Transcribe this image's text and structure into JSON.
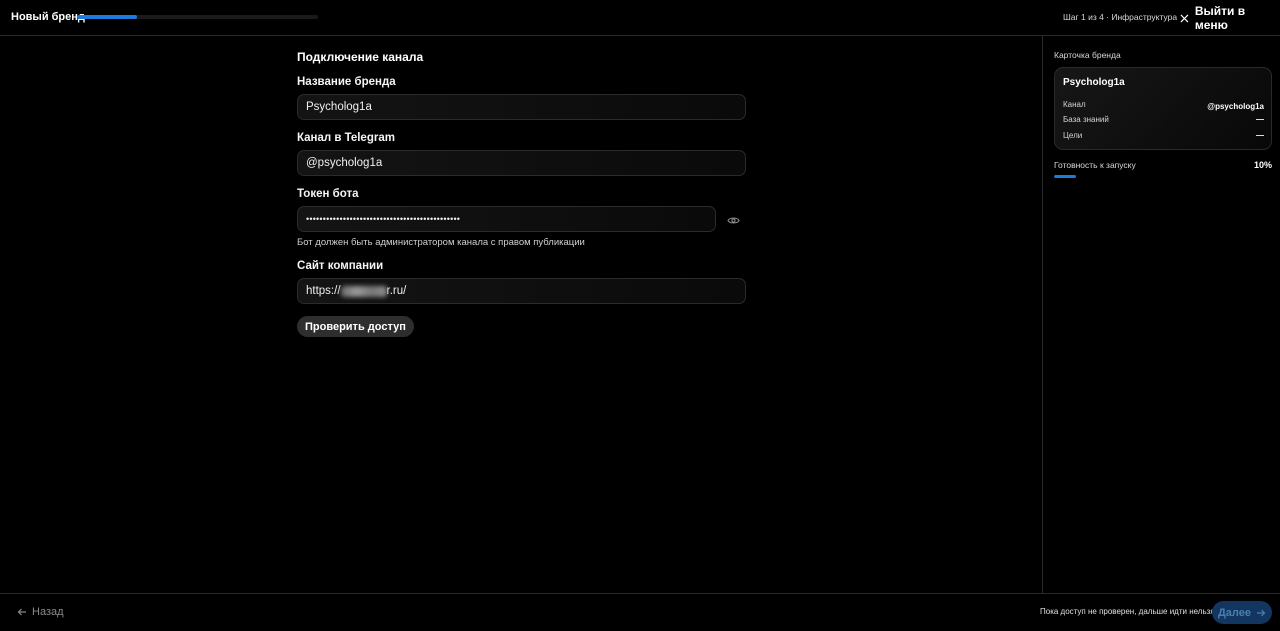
{
  "header": {
    "title": "Новый бренд",
    "progress": 0.25,
    "step_label": "Шаг 1 из 4 · Инфраструктура",
    "exit_label": "Выйти в меню"
  },
  "form": {
    "section_title": "Подключение канала",
    "brand_name": {
      "label": "Название бренда",
      "value": "Psycholog1a"
    },
    "channel": {
      "label": "Канал в Telegram",
      "value": "@psycholog1a"
    },
    "token": {
      "label": "Токен бота",
      "value": "••••••••••••••••••••••••••••••••••••••••••••••",
      "hint": "Бот должен быть администратором канала с правом публикации"
    },
    "site": {
      "label": "Сайт компании",
      "value_prefix": "https://",
      "value_suffix": "r.ru/"
    },
    "check_button": "Проверить доступ"
  },
  "sidebar": {
    "title": "Карточка бренда",
    "card": {
      "name": "Psycholog1a",
      "rows": [
        {
          "label": "Канал",
          "value": "@psycholog1a"
        },
        {
          "label": "База знаний",
          "value": "—"
        },
        {
          "label": "Цели",
          "value": "—"
        }
      ]
    },
    "readiness": {
      "label": "Готовность к запуску",
      "value": "10%",
      "fraction": 0.1
    }
  },
  "footer": {
    "back_label": "Назад",
    "note": "Пока доступ не проверен, дальше идти нельзя",
    "next_label": "Далее"
  },
  "colors": {
    "accent": "#1d7be0",
    "next_button_bg": "#12365f",
    "background": "#000000"
  },
  "icons": {
    "exit": "close-icon",
    "eye": "eye-icon",
    "back": "arrow-left-icon",
    "next": "arrow-right-icon"
  }
}
